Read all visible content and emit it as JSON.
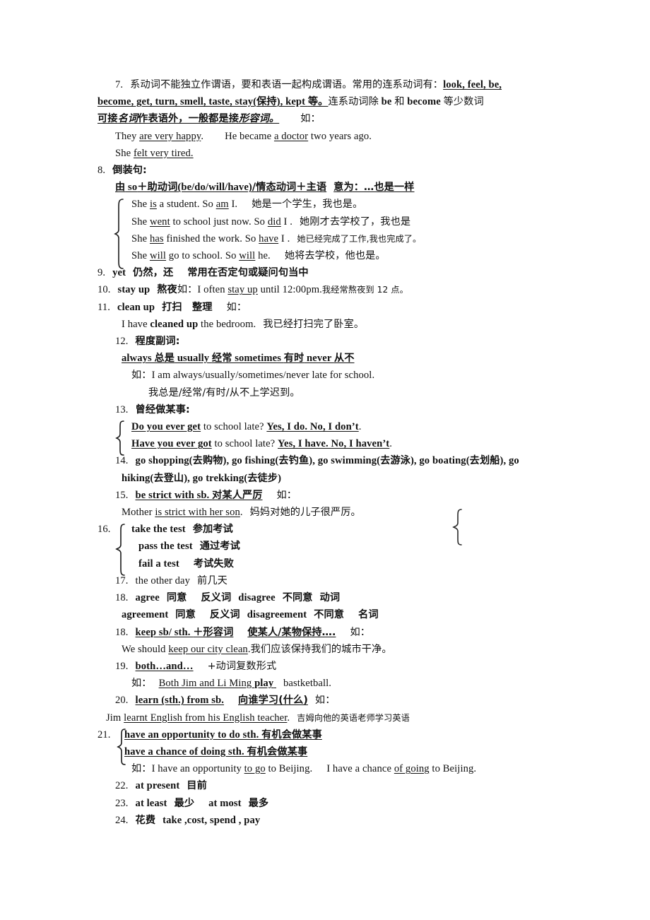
{
  "document": {
    "type": "study-notes",
    "language": "zh-CN + en",
    "items": [
      {
        "number": "7.",
        "lines": [
          "系动词不能独立作谓语，要和表语一起构成谓语。常用的连系动词有：",
          "look, feel, be, become, get, turn, smell, taste, stay(保持), kept 等。",
          "连系动词除 be 和 become 等少数词可接名词作表语外，一般都是接形容词。",
          "如：",
          "They are very happy.",
          "He became a doctor two years ago.",
          "She felt very tired."
        ]
      },
      {
        "number": "8.",
        "title": "倒装句:",
        "rule": "由 so＋助动词(be/do/will/have)/情态动词＋主语",
        "rule_meaning": "意为：…也是一样",
        "examples": [
          {
            "en": "She is a student. So am I.",
            "cn": "她是一个学生，我也是。"
          },
          {
            "en": "She went to school just now. So did I .",
            "cn": "她刚才去学校了，我也是"
          },
          {
            "en": "She has finished the work. So have I .",
            "cn": "她已经完成了工作,我也完成了。"
          },
          {
            "en": "She will go to school. So will he.",
            "cn": "她将去学校，他也是。"
          }
        ]
      },
      {
        "number": "9.",
        "term": "yet",
        "meaning": "仍然，还",
        "note": "常用在否定句或疑问句当中"
      },
      {
        "number": "10.",
        "term": "stay up",
        "meaning": "熬夜",
        "eg_label": "如：",
        "example_en": "I often stay up until 12:00pm.",
        "example_cn": "我经常熬夜到 12 点。"
      },
      {
        "number": "11.",
        "term": "clean up",
        "meaning": "打扫　整理",
        "eg_label": "如：",
        "example_en": "I have cleaned up the bedroom.",
        "example_cn": "我已经打扫完了卧室。"
      },
      {
        "number": "12.",
        "title": "程度副词:",
        "adverbs": "always 总是  usually 经常  sometimes 有时  never 从不",
        "eg_label": "如：",
        "example_en": "I am always/usually/sometimes/never late for school.",
        "example_cn": "我总是/经常/有时/从不上学迟到。"
      },
      {
        "number": "13.",
        "title": "曾经做某事:",
        "examples": [
          {
            "q": "Do you ever get",
            "rest": " to school late? ",
            "a": "Yes, I do. No, I don’t",
            "end": "."
          },
          {
            "q": "Have you ever got",
            "rest": " to school late? ",
            "a": "Yes, I have. No, I haven’t",
            "end": "."
          }
        ]
      },
      {
        "number": "14.",
        "phrases": "go shopping(去购物), go fishing(去钓鱼), go swimming(去游泳), go boating(去划船), go hiking(去登山), go trekking(去徒步)"
      },
      {
        "number": "15.",
        "term": "be strict with sb.",
        "meaning": "对某人严厉",
        "eg_label": "如：",
        "example_en": "Mother is strict with her son",
        "example_en_tail": ".",
        "example_cn": "妈妈对她的儿子很严厉。"
      },
      {
        "number": "16.",
        "braced": [
          {
            "en": "take the test",
            "cn": "参加考试"
          },
          {
            "en": "pass the test",
            "cn": "通过考试"
          },
          {
            "en": "fail a test",
            "cn": "考试失败"
          }
        ]
      },
      {
        "number": "17.",
        "term": "the other day",
        "meaning": "前几天"
      },
      {
        "number": "18.",
        "line1": "agree  同意   反义词  disagree 不同意 动词",
        "line2": "agreement 同意   反义词  disagreement 不同意   名词"
      },
      {
        "number": "18.",
        "term": "keep sb/ sth. ＋形容词",
        "meaning": "使某人/某物保持….",
        "eg_label": "如：",
        "example_en": "We should keep our city clean",
        "example_en_tail": ".",
        "example_cn": "我们应该保持我们的城市干净。"
      },
      {
        "number": "19.",
        "term": "both…and…",
        "note": "+动词复数形式",
        "eg_label": "如：",
        "example_en": "Both Jim and Li Ming play",
        "example_tail": "bastketball."
      },
      {
        "number": "20.",
        "term": "learn (sth.) from sb.",
        "meaning": "向谁学习(什么)",
        "eg_label": "如：",
        "example_en_pre": "Jim ",
        "example_en_u": "learnt English from his English teacher",
        "example_en_tail": ".",
        "example_cn": "吉姆向他的英语老师学习英语"
      },
      {
        "number": "21.",
        "braced": [
          {
            "en": "have an opportunity to do sth.",
            "cn": "有机会做某事"
          },
          {
            "en": "have a chance of doing sth.",
            "cn": "有机会做某事"
          }
        ],
        "eg_label": "如：",
        "example_a_pre": "I have an opportunity ",
        "example_a_u": "to go",
        "example_a_post": " to Beijing.",
        "example_b_pre": "I have a chance ",
        "example_b_u": "of going",
        "example_b_post": " to Beijing."
      },
      {
        "number": "22.",
        "term": "at present",
        "meaning": "目前"
      },
      {
        "number": "23.",
        "term1": "at least",
        "meaning1": "最少",
        "term2": "at most",
        "meaning2": "最多"
      },
      {
        "number": "24.",
        "meaning": "花费",
        "term": "take ,cost, spend , pay"
      }
    ],
    "stray_mark": "orphan-curly-brace"
  }
}
